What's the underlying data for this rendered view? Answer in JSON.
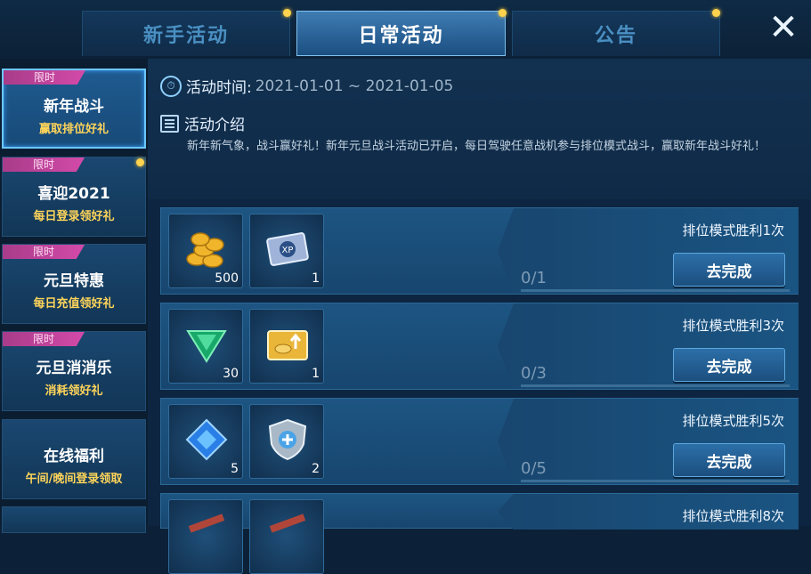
{
  "tabs": [
    {
      "label": "新手活动",
      "has_dot": true,
      "active": false
    },
    {
      "label": "日常活动",
      "has_dot": true,
      "active": true
    },
    {
      "label": "公告",
      "has_dot": true,
      "active": false
    }
  ],
  "close_icon": "close-icon",
  "sidebar": {
    "items": [
      {
        "badge": "限时",
        "title": "新年战斗",
        "subtitle": "赢取排位好礼",
        "active": true,
        "dot": false
      },
      {
        "badge": "限时",
        "title": "喜迎2021",
        "subtitle": "每日登录领好礼",
        "active": false,
        "dot": true
      },
      {
        "badge": "限时",
        "title": "元旦特惠",
        "subtitle": "每日充值领好礼",
        "active": false,
        "dot": false
      },
      {
        "badge": "限时",
        "title": "元旦消消乐",
        "subtitle": "消耗领好礼",
        "active": false,
        "dot": false
      },
      {
        "badge": "",
        "title": "在线福利",
        "subtitle": "午间/晚间登录领取",
        "active": false,
        "dot": false
      }
    ]
  },
  "activity": {
    "time_label": "活动时间:",
    "time_value": "2021-01-01 ~ 2021-01-05",
    "intro_label": "活动介绍",
    "intro_text": "新年新气象，战斗赢好礼！新年元旦战斗活动已开启，每日驾驶任意战机参与排位模式战斗，赢取新年战斗好礼！"
  },
  "tasks": [
    {
      "name": "排位模式胜利1次",
      "progress": "0/1",
      "button": "去完成",
      "rewards": [
        {
          "icon": "gold-coins-icon",
          "count": "500"
        },
        {
          "icon": "xp-card-icon",
          "count": "1"
        }
      ]
    },
    {
      "name": "排位模式胜利3次",
      "progress": "0/3",
      "button": "去完成",
      "rewards": [
        {
          "icon": "green-crystal-icon",
          "count": "30"
        },
        {
          "icon": "coin-folder-icon",
          "count": "1"
        }
      ]
    },
    {
      "name": "排位模式胜利5次",
      "progress": "0/5",
      "button": "去完成",
      "rewards": [
        {
          "icon": "blue-diamond-icon",
          "count": "5"
        },
        {
          "icon": "shield-icon",
          "count": "2"
        }
      ]
    },
    {
      "name": "排位模式胜利8次",
      "progress": "",
      "button": "",
      "rewards": [
        {
          "icon": "item-icon",
          "count": ""
        },
        {
          "icon": "item-icon",
          "count": ""
        }
      ]
    }
  ],
  "colors": {
    "accent_yellow": "#ffd55a",
    "badge_pink": "#d34aa8",
    "active_blue": "#6cc6ff"
  }
}
